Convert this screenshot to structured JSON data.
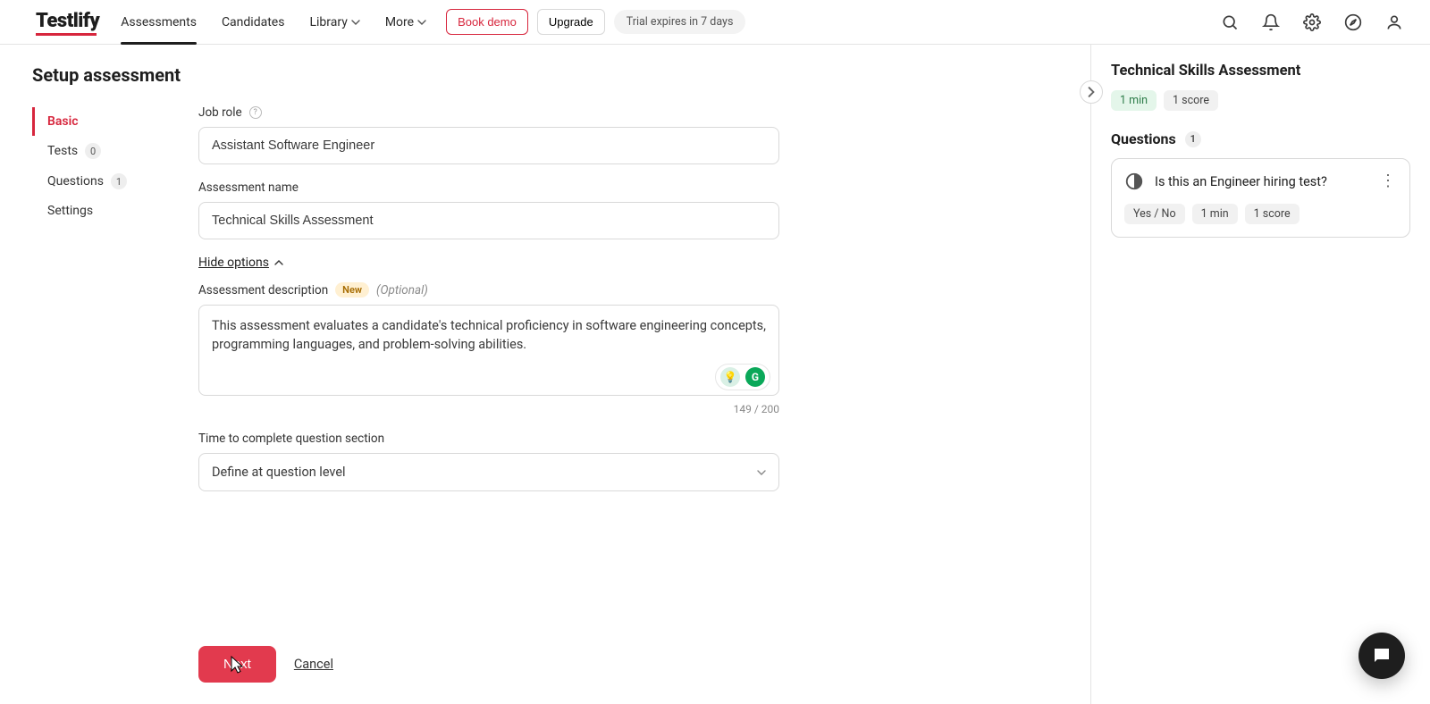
{
  "brand": "Testlify",
  "nav": {
    "assessments": "Assessments",
    "candidates": "Candidates",
    "library": "Library",
    "more": "More",
    "book_demo": "Book demo",
    "upgrade": "Upgrade",
    "trial": "Trial expires in 7 days"
  },
  "page": {
    "title": "Setup assessment"
  },
  "steps": {
    "basic": "Basic",
    "tests": "Tests",
    "tests_count": "0",
    "questions": "Questions",
    "questions_count": "1",
    "settings": "Settings"
  },
  "form": {
    "job_role_label": "Job role",
    "job_role_value": "Assistant Software Engineer",
    "name_label": "Assessment name",
    "name_value": "Technical Skills Assessment",
    "hide_options": "Hide options",
    "desc_label": "Assessment description",
    "new_badge": "New",
    "optional": "(Optional)",
    "desc_value": "This assessment evaluates a candidate's technical proficiency in software engineering concepts, programming languages, and problem-solving abilities.",
    "char_counter": "149 / 200",
    "time_label": "Time to complete question section",
    "time_value": "Define at question level",
    "grammarly_g": "G",
    "bulb": "💡"
  },
  "footer": {
    "next": "Next",
    "cancel": "Cancel"
  },
  "rpanel": {
    "title": "Technical Skills Assessment",
    "time_chip": "1 min",
    "score_chip": "1 score",
    "questions_heading": "Questions",
    "questions_count": "1",
    "q1": {
      "title": "Is this an Engineer hiring test?",
      "type_chip": "Yes / No",
      "time_chip": "1 min",
      "score_chip": "1 score"
    }
  }
}
